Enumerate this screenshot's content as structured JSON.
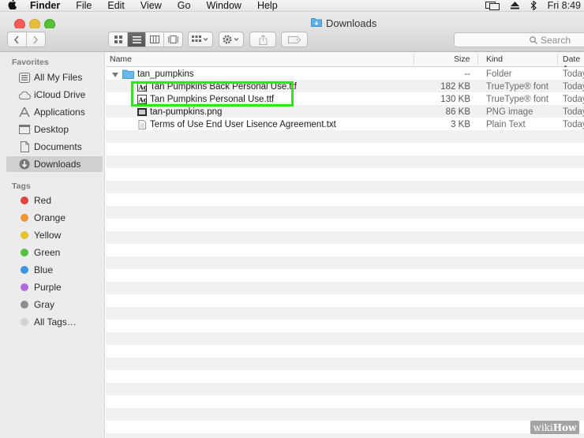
{
  "menubar": {
    "app_name": "Finder",
    "menus": [
      "File",
      "Edit",
      "View",
      "Go",
      "Window",
      "Help"
    ],
    "clock": "Fri 8:49"
  },
  "window": {
    "title": "Downloads"
  },
  "toolbar": {
    "search_placeholder": "Search"
  },
  "sidebar": {
    "favorites_header": "Favorites",
    "favorites": [
      {
        "label": "All My Files",
        "icon": "all-files-icon"
      },
      {
        "label": "iCloud Drive",
        "icon": "cloud-icon"
      },
      {
        "label": "Applications",
        "icon": "applications-icon"
      },
      {
        "label": "Desktop",
        "icon": "desktop-icon"
      },
      {
        "label": "Documents",
        "icon": "documents-icon"
      },
      {
        "label": "Downloads",
        "icon": "downloads-icon"
      }
    ],
    "tags_header": "Tags",
    "tags": [
      {
        "label": "Red",
        "color": "#e0443e"
      },
      {
        "label": "Orange",
        "color": "#f0962e"
      },
      {
        "label": "Yellow",
        "color": "#e6c22d"
      },
      {
        "label": "Green",
        "color": "#56c143"
      },
      {
        "label": "Blue",
        "color": "#3c96e0"
      },
      {
        "label": "Purple",
        "color": "#b36ad9"
      },
      {
        "label": "Gray",
        "color": "#8e8e8e"
      },
      {
        "label": "All Tags…",
        "color": "#d2d2d2"
      }
    ]
  },
  "columns": {
    "name": "Name",
    "size": "Size",
    "kind": "Kind",
    "date": "Date A"
  },
  "files": [
    {
      "name": "tan_pumpkins",
      "size": "--",
      "kind": "Folder",
      "date": "Today"
    },
    {
      "name": "Tan Pumpkins Back Personal Use.ttf",
      "size": "182 KB",
      "kind": "TrueType® font",
      "date": "Today"
    },
    {
      "name": "Tan Pumpkins Personal Use.ttf",
      "size": "130 KB",
      "kind": "TrueType® font",
      "date": "Today"
    },
    {
      "name": "tan-pumpkins.png",
      "size": "86 KB",
      "kind": "PNG image",
      "date": "Today"
    },
    {
      "name": "Terms of Use End User Lisence Agreement.txt",
      "size": "3 KB",
      "kind": "Plain Text",
      "date": "Today"
    }
  ],
  "watermark": {
    "text_a": "wiki",
    "text_b": "How"
  }
}
